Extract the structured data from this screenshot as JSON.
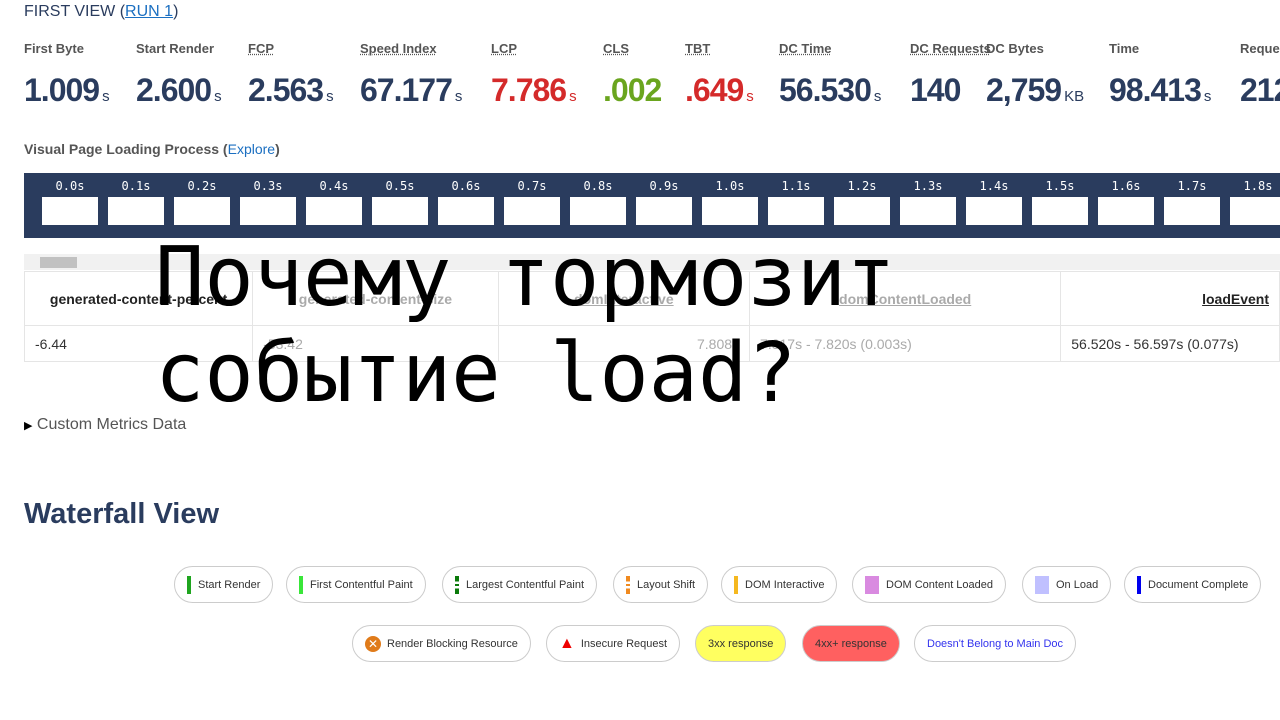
{
  "header": {
    "prefix": "FIRST VIEW (",
    "run_link": "RUN 1",
    "suffix": ")"
  },
  "metrics": [
    {
      "label": "First Byte",
      "value": "1.009",
      "unit": "s",
      "color": "#2a3c5e"
    },
    {
      "label": "Start Render",
      "value": "2.600",
      "unit": "s",
      "color": "#2a3c5e"
    },
    {
      "label": "FCP",
      "value": "2.563",
      "unit": "s",
      "color": "#2a3c5e"
    },
    {
      "label": "Speed Index",
      "value": "67.177",
      "unit": "s",
      "color": "#2a3c5e"
    },
    {
      "label": "LCP",
      "value": "7.786",
      "unit": "s",
      "color": "#d42a2a"
    },
    {
      "label": "CLS",
      "value": ".002",
      "unit": "",
      "color": "#6aa51e"
    },
    {
      "label": "TBT",
      "value": ".649",
      "unit": "s",
      "color": "#d42a2a"
    },
    {
      "label": "DC Time",
      "value": "56.530",
      "unit": "s",
      "color": "#2a3c5e"
    },
    {
      "label": "DC Requests",
      "value": "140",
      "unit": "",
      "color": "#2a3c5e"
    },
    {
      "label": "DC Bytes",
      "value": "2,759",
      "unit": "KB",
      "color": "#2a3c5e"
    },
    {
      "label": "Time",
      "value": "98.413",
      "unit": "s",
      "color": "#2a3c5e"
    },
    {
      "label": "Reque",
      "value": "212",
      "unit": "",
      "color": "#2a3c5e"
    }
  ],
  "visual": {
    "title": "Visual Page Loading Process",
    "explore": "Explore",
    "frames": [
      "0.0s",
      "0.1s",
      "0.2s",
      "0.3s",
      "0.4s",
      "0.5s",
      "0.6s",
      "0.7s",
      "0.8s",
      "0.9s",
      "1.0s",
      "1.1s",
      "1.2s",
      "1.3s",
      "1.4s",
      "1.5s",
      "1.6s",
      "1.7s",
      "1.8s"
    ]
  },
  "table": {
    "headers": [
      "generated-content-percent",
      "generated-content-size",
      "domInteractive",
      "domContentLoaded",
      "loadEvent"
    ],
    "row": [
      "-6.44",
      "-53.42",
      "7.808s",
      "7.817s - 7.820s (0.003s)",
      "56.520s - 56.597s (0.077s)"
    ]
  },
  "custom_metrics": "Custom Metrics Data",
  "waterfall": {
    "title": "Waterfall View",
    "legend1": [
      {
        "label": "Start Render",
        "color": "#1fa51f"
      },
      {
        "label": "First Contentful Paint",
        "color": "#39e639"
      },
      {
        "label": "Largest Contentful Paint",
        "color": "#0a7a0a"
      },
      {
        "label": "Layout Shift",
        "color": "#f08a1f"
      },
      {
        "label": "DOM Interactive",
        "color": "#f5b81f"
      },
      {
        "label": "DOM Content Loaded",
        "color": "#d98ae0"
      },
      {
        "label": "On Load",
        "color": "#c0c0ff"
      },
      {
        "label": "Document Complete",
        "color": "#0000ee"
      }
    ],
    "legend2": [
      "Render Blocking Resource",
      "Insecure Request",
      "3xx response",
      "4xx+ response",
      "Doesn't Belong to Main Doc"
    ]
  },
  "overlay": {
    "line1": "Почему тормозит",
    "line2": "событие load?"
  }
}
